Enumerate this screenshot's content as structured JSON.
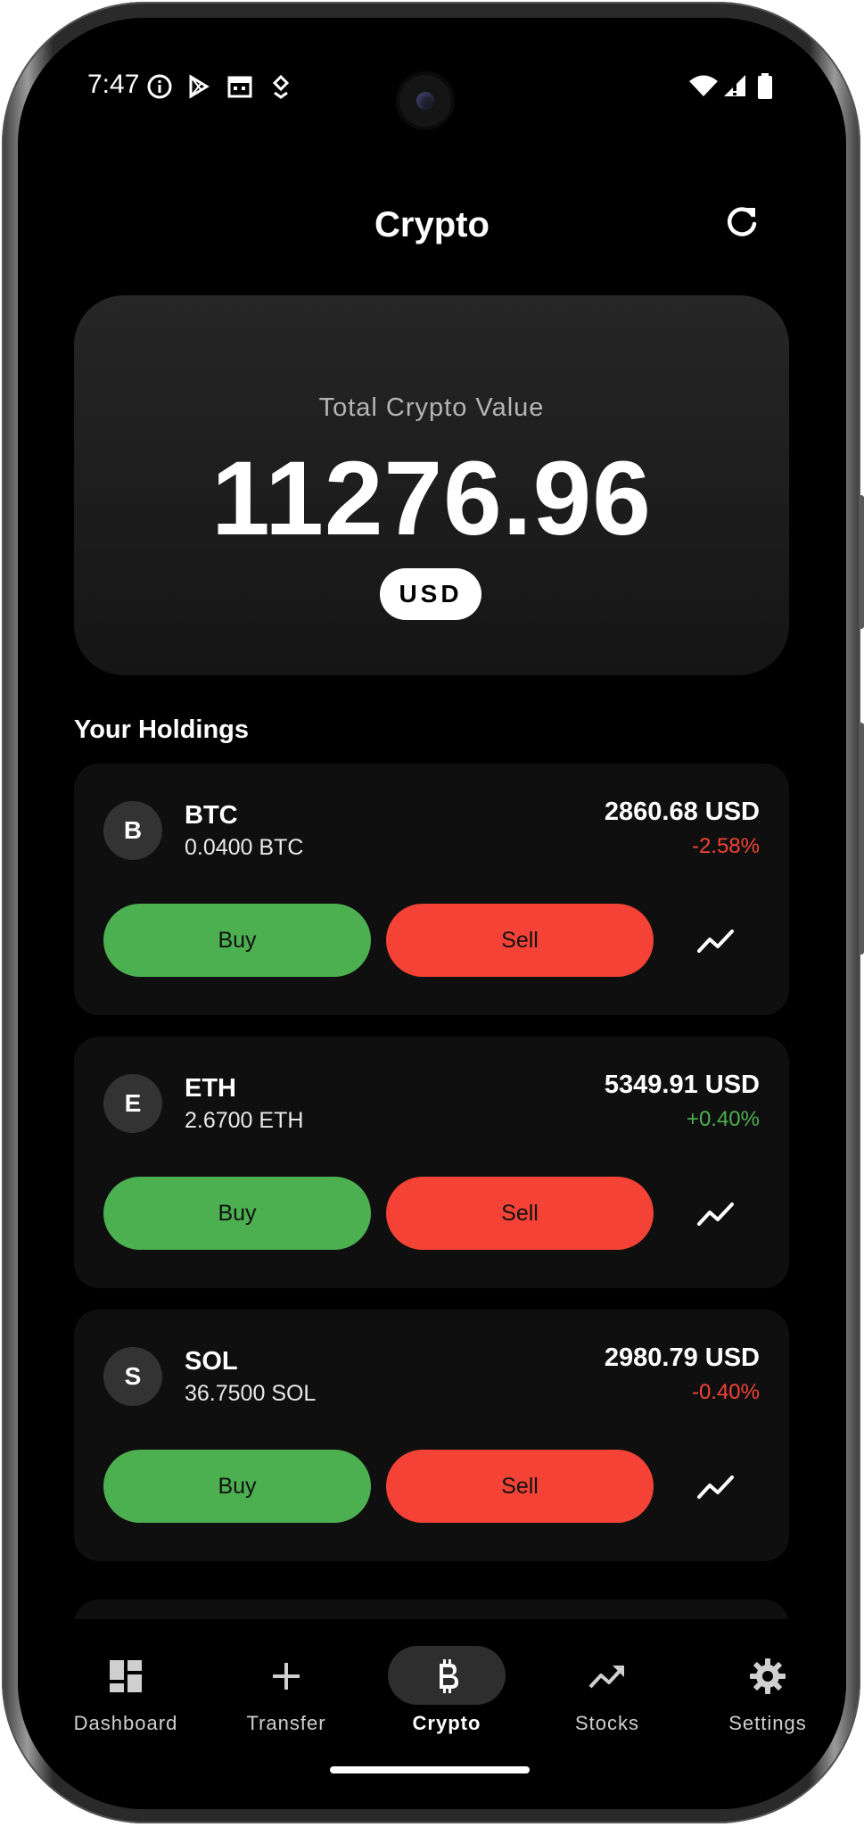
{
  "status": {
    "time": "7:47"
  },
  "header": {
    "title": "Crypto"
  },
  "summary": {
    "label": "Total Crypto Value",
    "value": "11276.96",
    "currency": "USD"
  },
  "holdings": {
    "title": "Your Holdings",
    "items": [
      {
        "initial": "B",
        "symbol": "BTC",
        "quantity": "0.0400 BTC",
        "value": "2860.68 USD",
        "change": "-2.58%",
        "change_color": "#f44336",
        "buy": "Buy",
        "sell": "Sell"
      },
      {
        "initial": "E",
        "symbol": "ETH",
        "quantity": "2.6700 ETH",
        "value": "5349.91 USD",
        "change": "+0.40%",
        "change_color": "#4caf50",
        "buy": "Buy",
        "sell": "Sell"
      },
      {
        "initial": "S",
        "symbol": "SOL",
        "quantity": "36.7500 SOL",
        "value": "2980.79 USD",
        "change": "-0.40%",
        "change_color": "#f44336",
        "buy": "Buy",
        "sell": "Sell"
      }
    ]
  },
  "nav": {
    "items": [
      {
        "label": "Dashboard",
        "icon": "dashboard-icon"
      },
      {
        "label": "Transfer",
        "icon": "plus-icon"
      },
      {
        "label": "Crypto",
        "icon": "bitcoin-icon",
        "active": true
      },
      {
        "label": "Stocks",
        "icon": "trending-up-icon"
      },
      {
        "label": "Settings",
        "icon": "gear-icon"
      }
    ]
  },
  "colors": {
    "buy": "#4caf50",
    "sell": "#f44336",
    "background": "#000000",
    "card": "#0f0f0f"
  }
}
